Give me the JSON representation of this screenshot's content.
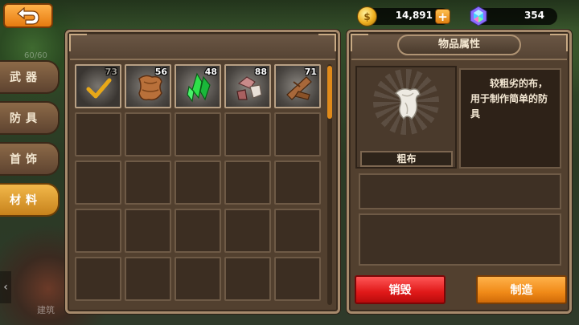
{
  "header": {
    "gold_value": "14,891",
    "gold_icon_glyph": "$",
    "gold_plus": "+",
    "gem_value": "354"
  },
  "side_tabs": [
    {
      "label": "武器",
      "active": false
    },
    {
      "label": "防具",
      "active": false
    },
    {
      "label": "首饰",
      "active": false
    },
    {
      "label": "材料",
      "active": true
    }
  ],
  "side_faded_text": "60/60",
  "build_label": "建筑",
  "left_arrow": "‹",
  "inventory": {
    "items": [
      {
        "name": "unknown-material",
        "icon": "check-icon",
        "qty": "73",
        "selected": true
      },
      {
        "name": "leather",
        "icon": "leather-icon",
        "qty": "56",
        "selected": false
      },
      {
        "name": "emerald-crystal",
        "icon": "crystal-icon",
        "qty": "48",
        "selected": false
      },
      {
        "name": "ore",
        "icon": "ore-icon",
        "qty": "88",
        "selected": false
      },
      {
        "name": "wood",
        "icon": "wood-icon",
        "qty": "71",
        "selected": false
      }
    ],
    "columns": 5,
    "rows_visible": 5
  },
  "properties": {
    "title": "物品属性",
    "item_name": "粗布",
    "item_icon": "cloth-icon",
    "description": "较粗劣的布，用于制作简单的防具"
  },
  "actions": {
    "destroy_label": "销毁",
    "craft_label": "制造"
  },
  "colors": {
    "destroy": "#e01818",
    "craft": "#f08a18",
    "active_tab": "#f2b84a"
  }
}
